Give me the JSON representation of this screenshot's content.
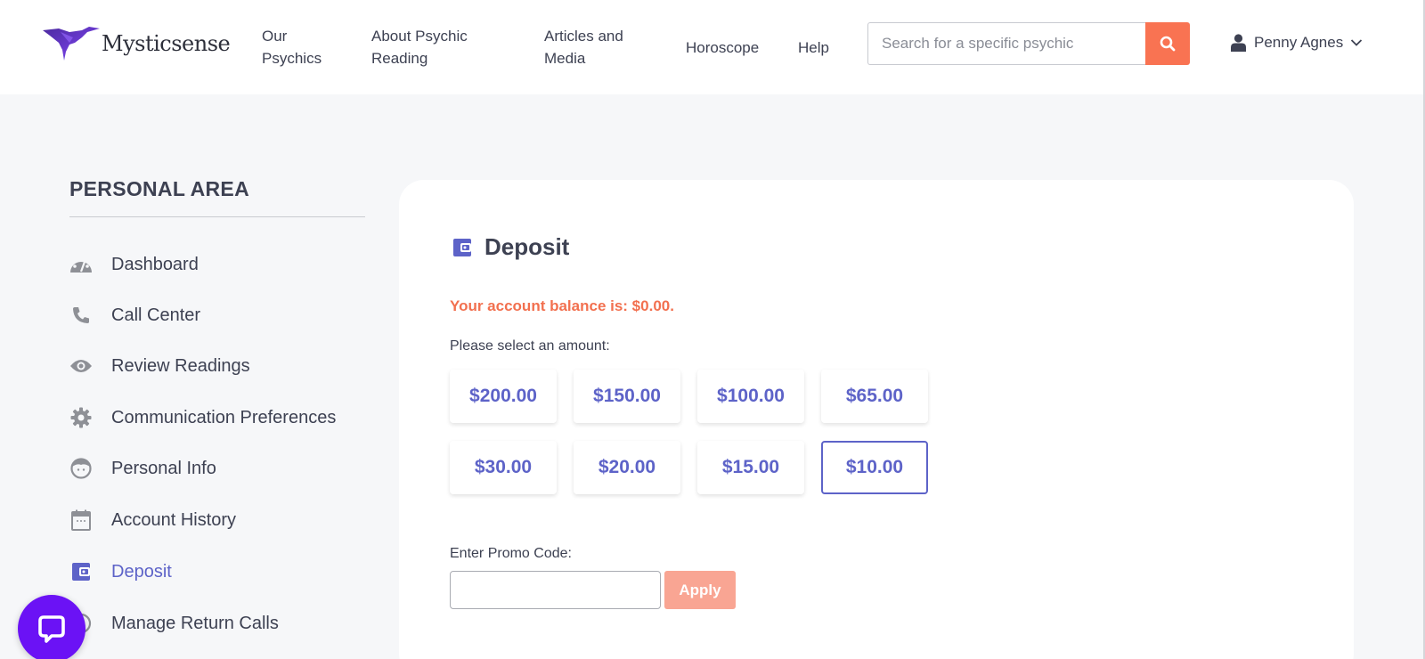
{
  "header": {
    "brand": "Mysticsense",
    "nav": [
      {
        "label": "Our Psychics",
        "line1": "Our",
        "line2": "Psychics"
      },
      {
        "label": "About Psychic Reading",
        "line1": "About Psychic",
        "line2": "Reading"
      },
      {
        "label": "Articles and Media",
        "line1": "Articles and",
        "line2": "Media"
      },
      {
        "label": "Horoscope"
      },
      {
        "label": "Help"
      }
    ],
    "search": {
      "placeholder": "Search for a specific psychic",
      "value": "",
      "icon": "search-icon"
    },
    "user": {
      "name": "Penny Agnes",
      "icon": "user-icon",
      "dropdown_icon": "chevron-down-icon"
    }
  },
  "sidebar": {
    "title": "PERSONAL AREA",
    "items": [
      {
        "label": "Dashboard",
        "icon": "dashboard-icon",
        "active": false
      },
      {
        "label": "Call Center",
        "icon": "phone-icon",
        "active": false
      },
      {
        "label": "Review Readings",
        "icon": "eye-icon",
        "active": false
      },
      {
        "label": "Communication Preferences",
        "icon": "gear-icon",
        "active": false
      },
      {
        "label": "Personal Info",
        "icon": "face-icon",
        "active": false
      },
      {
        "label": "Account History",
        "icon": "calendar-icon",
        "active": false
      },
      {
        "label": "Deposit",
        "icon": "wallet-icon",
        "active": true
      },
      {
        "label": "Manage Return Calls",
        "icon": "clock-icon",
        "active": false
      }
    ]
  },
  "deposit": {
    "title": "Deposit",
    "balance_text": "Your account balance is: $0.00.",
    "select_label": "Please select an amount:",
    "amounts": [
      "$200.00",
      "$150.00",
      "$100.00",
      "$65.00",
      "$30.00",
      "$20.00",
      "$15.00",
      "$10.00"
    ],
    "selected_amount": "$10.00",
    "promo_label": "Enter Promo Code:",
    "promo_value": "",
    "apply_label": "Apply"
  },
  "colors": {
    "accent": "#5d63c8",
    "orange": "#f97352",
    "balance": "#f2704f",
    "chat": "#6b12f5"
  }
}
